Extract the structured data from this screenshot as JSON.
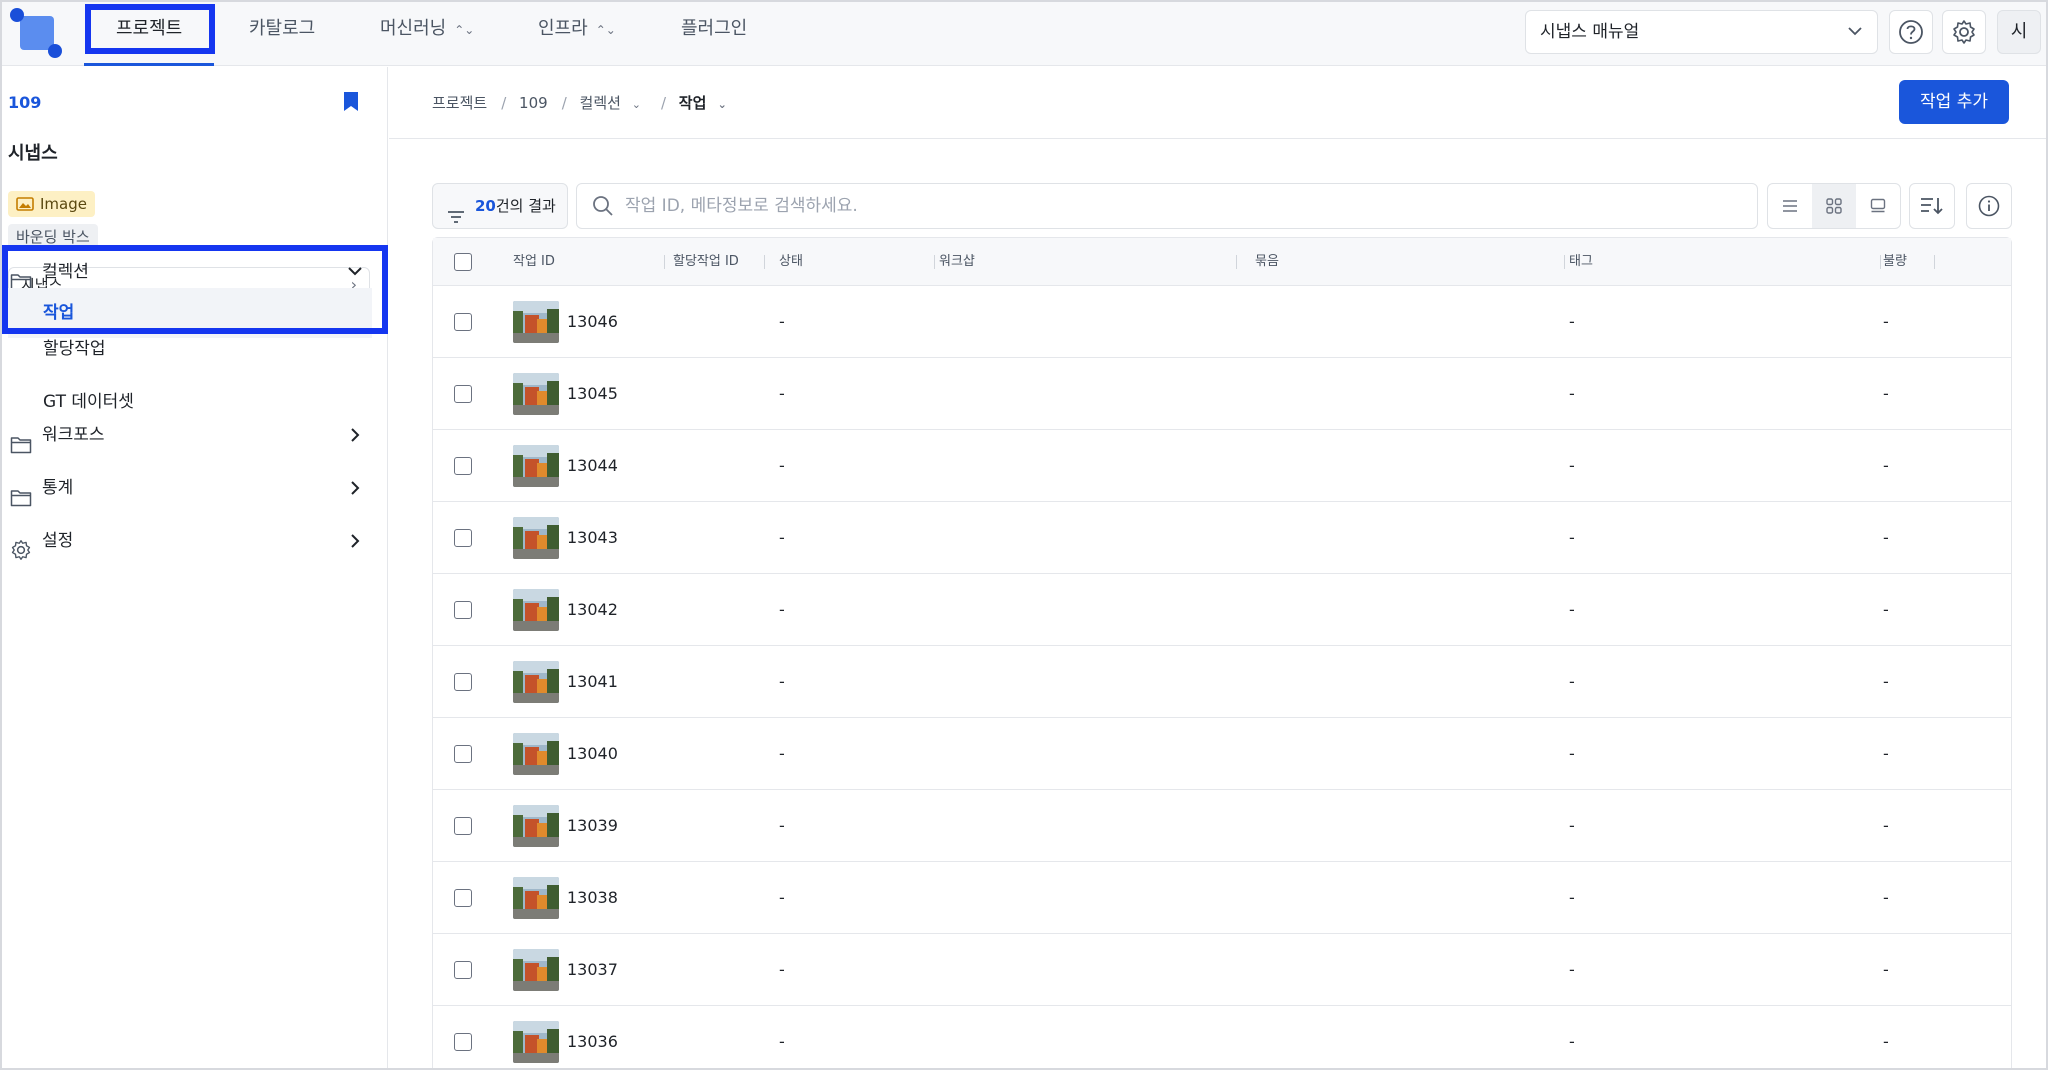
{
  "nav": {
    "items": [
      {
        "label": "프로젝트",
        "chevron": false
      },
      {
        "label": "카탈로그",
        "chevron": false
      },
      {
        "label": "머신러닝",
        "chevron": true
      },
      {
        "label": "인프라",
        "chevron": true
      },
      {
        "label": "플러그인",
        "chevron": false
      }
    ],
    "manual_select": "시냅스 매뉴얼",
    "avatar": "시"
  },
  "sidebar": {
    "project_id": "109",
    "project_name": "시냅스",
    "badge_image": "Image",
    "badge_bbox": "바운딩 박스",
    "project_select": "시냅스",
    "collection": "컬렉션",
    "sub_items": [
      "작업",
      "할당작업",
      "GT 데이터셋"
    ],
    "workforce": "워크포스",
    "stats": "통계",
    "settings": "설정"
  },
  "breadcrumb": {
    "root": "프로젝트",
    "project": "109",
    "collection": "컬렉션",
    "current": "작업"
  },
  "actions": {
    "add_task": "작업 추가"
  },
  "toolbar": {
    "result_count": "20",
    "result_suffix": "건의 결과",
    "search_placeholder": "작업 ID, 메타정보로 검색하세요."
  },
  "table": {
    "columns": [
      "작업 ID",
      "할당작업 ID",
      "상태",
      "워크샵",
      "묶음",
      "태그",
      "불량"
    ],
    "rows": [
      {
        "id": "13046",
        "status": "-",
        "tag": "-",
        "defect": "-"
      },
      {
        "id": "13045",
        "status": "-",
        "tag": "-",
        "defect": "-"
      },
      {
        "id": "13044",
        "status": "-",
        "tag": "-",
        "defect": "-"
      },
      {
        "id": "13043",
        "status": "-",
        "tag": "-",
        "defect": "-"
      },
      {
        "id": "13042",
        "status": "-",
        "tag": "-",
        "defect": "-"
      },
      {
        "id": "13041",
        "status": "-",
        "tag": "-",
        "defect": "-"
      },
      {
        "id": "13040",
        "status": "-",
        "tag": "-",
        "defect": "-"
      },
      {
        "id": "13039",
        "status": "-",
        "tag": "-",
        "defect": "-"
      },
      {
        "id": "13038",
        "status": "-",
        "tag": "-",
        "defect": "-"
      },
      {
        "id": "13037",
        "status": "-",
        "tag": "-",
        "defect": "-"
      },
      {
        "id": "13036",
        "status": "-",
        "tag": "-",
        "defect": "-"
      }
    ]
  },
  "colors": {
    "accent": "#1a56db",
    "highlight_box": "#1536f0",
    "image_badge_bg": "#fdf0c4"
  }
}
